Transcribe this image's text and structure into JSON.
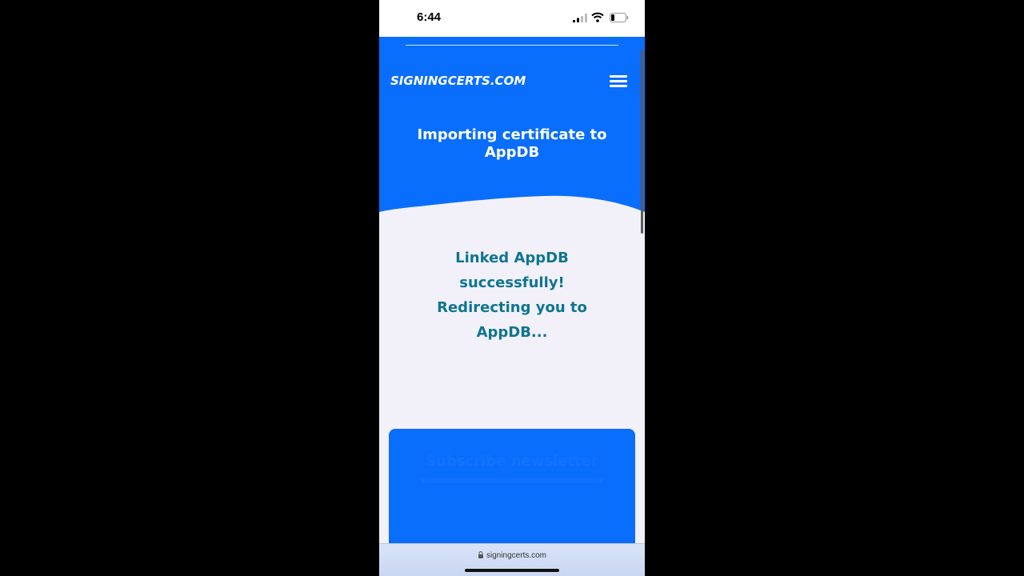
{
  "status_bar": {
    "time": "6:44",
    "icons": [
      "signal-icon",
      "wifi-icon",
      "battery-icon"
    ]
  },
  "header": {
    "logo_text": "SIGNINGCERTS.COM",
    "menu_icon": "hamburger-menu-icon",
    "title": "Importing certificate to AppDB"
  },
  "main": {
    "message": "Linked AppDB successfully! Redirecting you to AppDB..."
  },
  "newsletter": {
    "title": "Subscribe newsletter"
  },
  "browser": {
    "url": "signingcerts.com",
    "lock_icon": "lock-icon"
  },
  "colors": {
    "brand_blue": "#0a6efc",
    "message_teal": "#0f7590",
    "page_bg": "#f2f1f9"
  }
}
